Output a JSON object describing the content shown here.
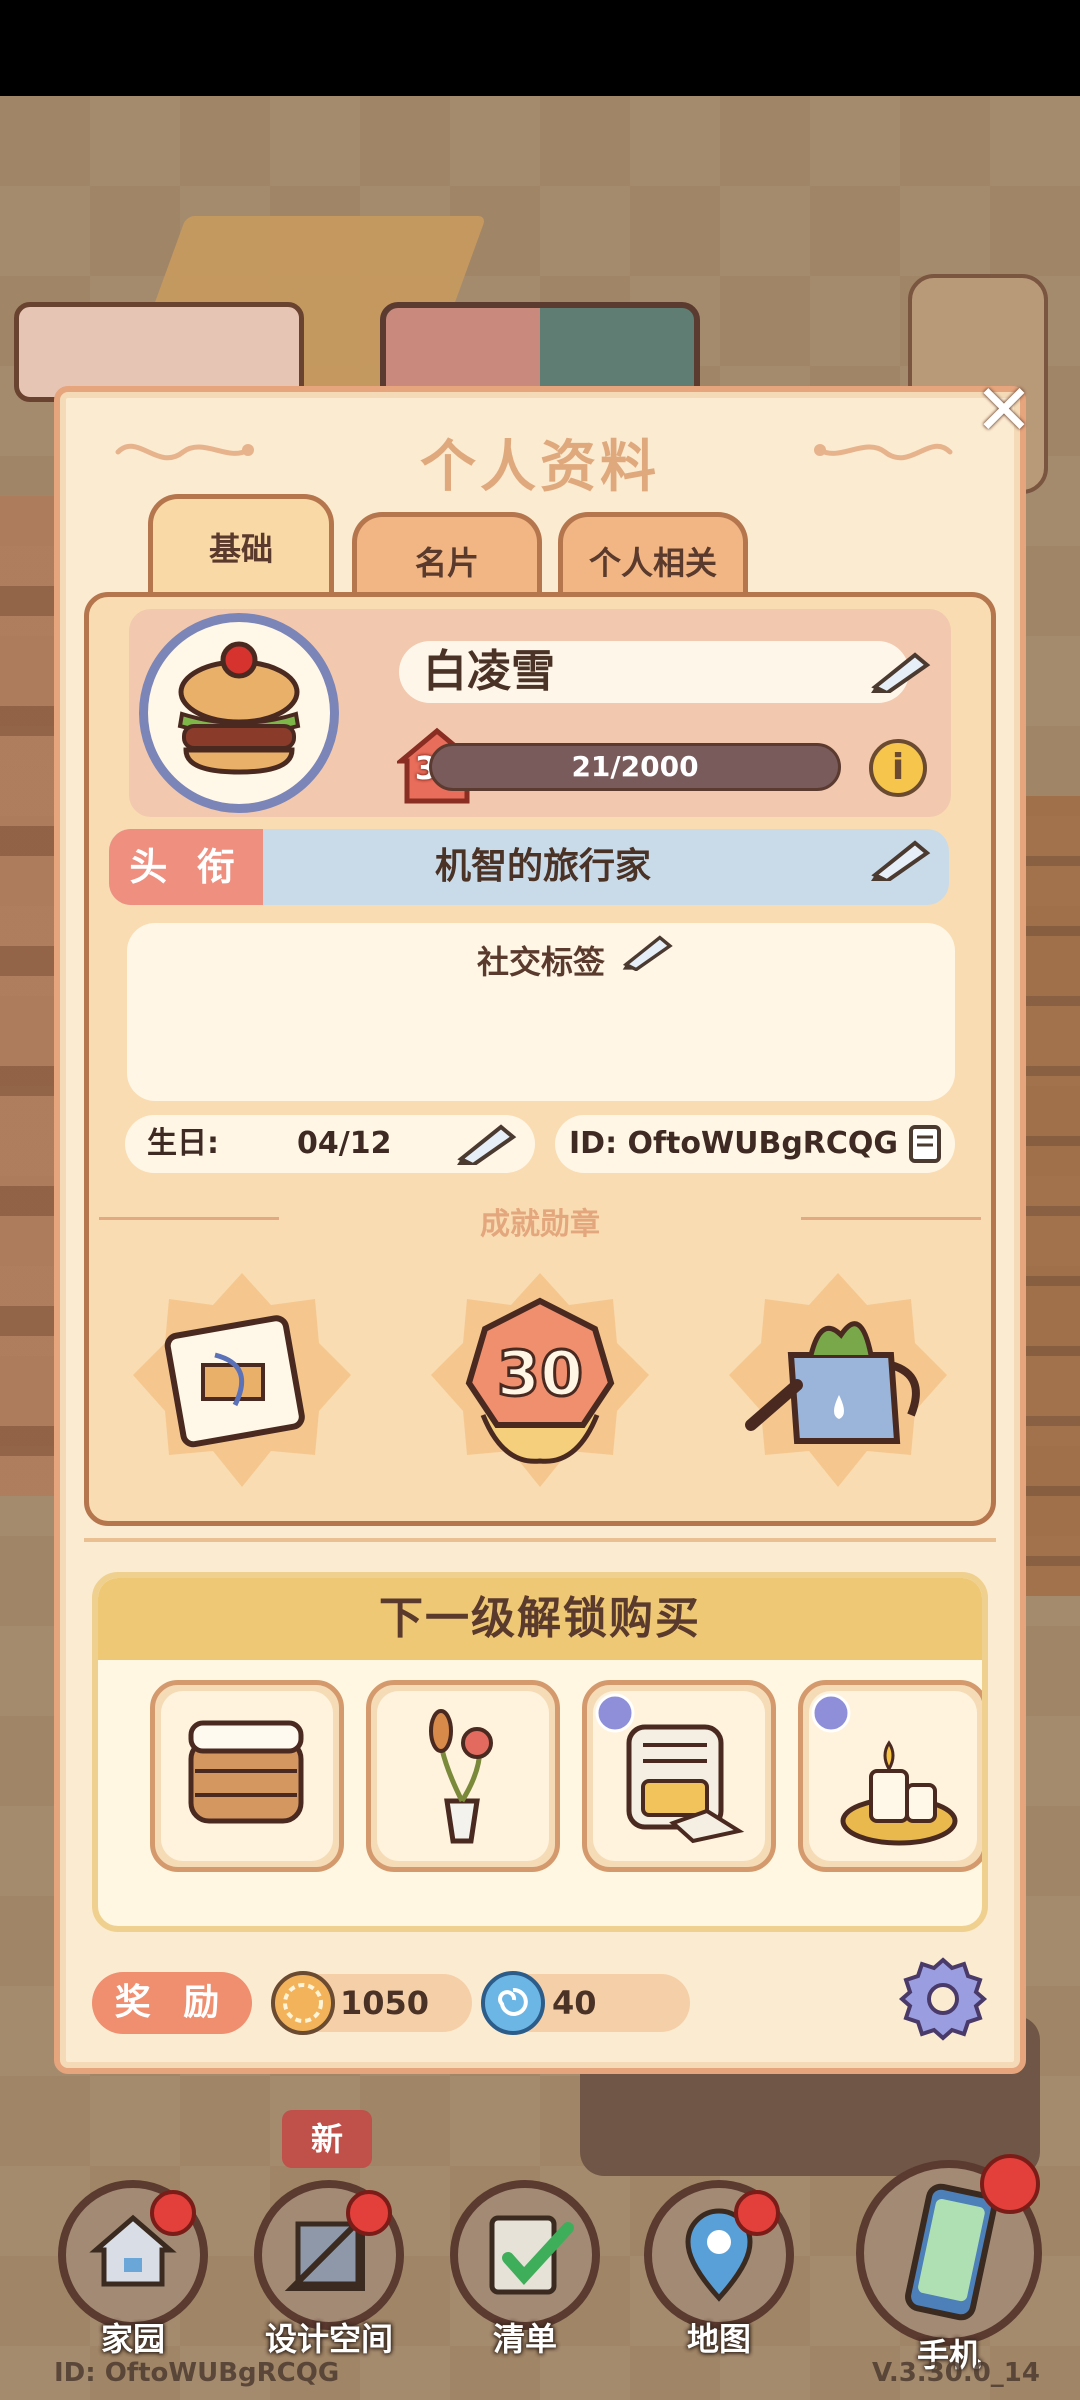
{
  "panel": {
    "title": "个人资料",
    "tabs": [
      {
        "label": "基础"
      },
      {
        "label": "名片"
      },
      {
        "label": "个人相关"
      }
    ]
  },
  "profile": {
    "name": "白凌雪",
    "level": "39",
    "xp_text": "21/2000",
    "xp_fraction": 0.0105,
    "title_label": "头 衔",
    "title_value": "机智的旅行家",
    "social_tags_label": "社交标签",
    "birthday_label": "生日:",
    "birthday_value": "04/12",
    "id_text": "ID: OftoWUBgRCQG"
  },
  "achievements": {
    "label": "成就勋章",
    "medals": [
      {
        "icon": "scroll-icon"
      },
      {
        "icon": "level-30-badge",
        "text": "30"
      },
      {
        "icon": "watering-can-icon"
      }
    ]
  },
  "unlock": {
    "title": "下一级解锁购买",
    "items": [
      {
        "icon": "cabinet-icon"
      },
      {
        "icon": "flower-vase-icon"
      },
      {
        "icon": "oven-icon"
      },
      {
        "icon": "candle-icon"
      }
    ]
  },
  "rewards": {
    "label": "奖 励",
    "coins": "1050",
    "gems": "40"
  },
  "nav": {
    "items": [
      {
        "label": "家园",
        "icon": "home-icon"
      },
      {
        "label": "设计空间",
        "icon": "design-icon"
      },
      {
        "label": "清单",
        "icon": "checklist-icon"
      },
      {
        "label": "地图",
        "icon": "map-pin-icon"
      },
      {
        "label": "手机",
        "icon": "phone-icon"
      }
    ],
    "new_badge": "新"
  },
  "footer": {
    "id": "ID: OftoWUBgRCQG",
    "version": "V.3.30.0_14"
  },
  "colors": {
    "panel_bg": "#fbebd0",
    "accent": "#f08e70",
    "xp_bar": "#7a5b5c"
  }
}
